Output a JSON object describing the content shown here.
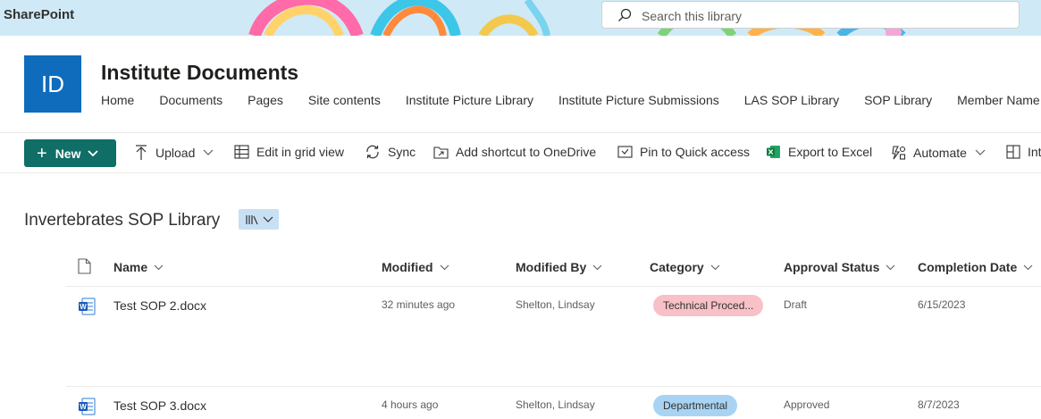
{
  "app": {
    "brand": "SharePoint"
  },
  "search": {
    "placeholder": "Search this library"
  },
  "site": {
    "logo_initials": "ID",
    "title": "Institute Documents",
    "logo_color": "#0f6cbd",
    "nav": [
      "Home",
      "Documents",
      "Pages",
      "Site contents",
      "Institute Picture Library",
      "Institute Picture Submissions",
      "LAS SOP Library",
      "SOP Library",
      "Member Name Pro"
    ]
  },
  "commandbar": {
    "new_label": "New",
    "upload": "Upload",
    "edit_grid": "Edit in grid view",
    "sync": "Sync",
    "add_shortcut": "Add shortcut to OneDrive",
    "pin": "Pin to Quick access",
    "export": "Export to Excel",
    "automate": "Automate",
    "integrate": "Int",
    "accent": "#0f6e66"
  },
  "library": {
    "title": "Invertebrates SOP Library"
  },
  "columns": {
    "name": "Name",
    "modified": "Modified",
    "modified_by": "Modified By",
    "category": "Category",
    "approval": "Approval Status",
    "completion": "Completion Date"
  },
  "rows": [
    {
      "icon": "word-doc-icon",
      "name": "Test SOP 2.docx",
      "modified": "32 minutes ago",
      "modified_by": "Shelton, Lindsay",
      "category": "Technical Proced...",
      "category_color": "#f7c1c7",
      "approval": "Draft",
      "completion": "6/15/2023"
    },
    {
      "icon": "word-doc-icon",
      "name": "Test SOP 3.docx",
      "modified": "4 hours ago",
      "modified_by": "Shelton, Lindsay",
      "category": "Departmental",
      "category_color": "#a9d3f2",
      "approval": "Approved",
      "completion": "8/7/2023"
    }
  ]
}
